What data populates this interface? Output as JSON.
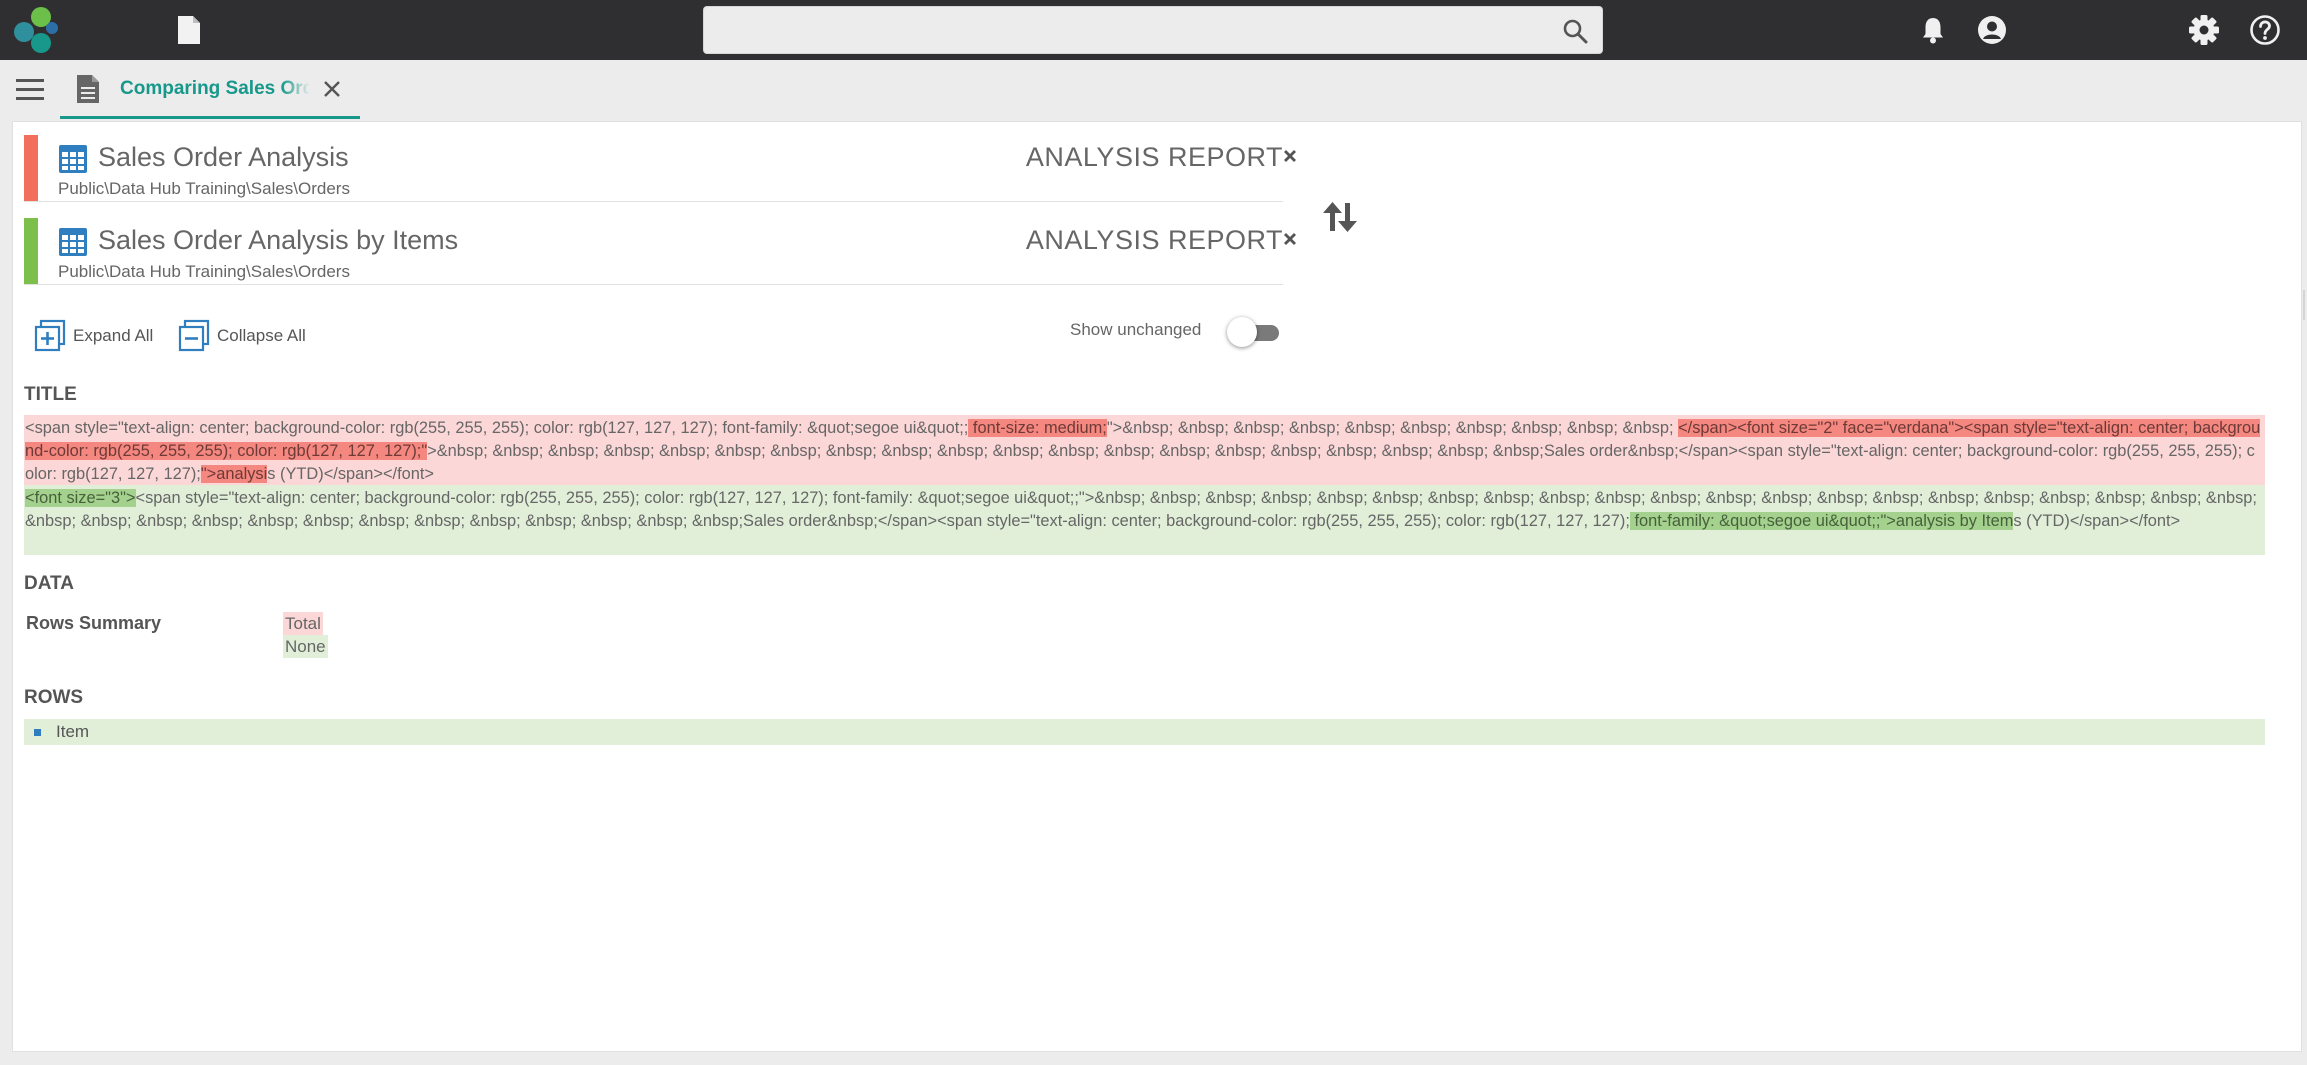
{
  "search": {
    "placeholder": ""
  },
  "tab": {
    "label": "Comparing Sales Order Analysis"
  },
  "reports": [
    {
      "title": "Sales Order Analysis",
      "path": "Public\\Data Hub Training\\Sales\\Orders",
      "type": "ANALYSIS REPORT",
      "color": "#f26f5e"
    },
    {
      "title": "Sales Order Analysis by Items",
      "path": "Public\\Data Hub Training\\Sales\\Orders",
      "type": "ANALYSIS REPORT",
      "color": "#7cc04b"
    }
  ],
  "remove_glyph": "×",
  "toolbar": {
    "expand_all": "Expand All",
    "collapse_all": "Collapse All",
    "show_unchanged": "Show unchanged",
    "show_unchanged_on": false
  },
  "sections": {
    "title": "TITLE",
    "data": "DATA",
    "rows": "ROWS"
  },
  "title_diff": {
    "old": [
      {
        "text": "<span style=\"text-align: center; background-color: rgb(255, 255, 255); color: rgb(127, 127, 127); font-family: &quot;segoe ui&quot;;",
        "hl": false
      },
      {
        "text": " font-size: medium;",
        "hl": true
      },
      {
        "text": "\">&nbsp; &nbsp; &nbsp; &nbsp; &nbsp; &nbsp; &nbsp; &nbsp; &nbsp; &nbsp; ",
        "hl": false
      },
      {
        "text": "</span><font size=\"2\" face=\"verdana\"><span style=\"text-align: center; background-color: rgb(255, 255, 255); color: rgb(127, 127, 127);\"",
        "hl": true
      },
      {
        "text": ">&nbsp; &nbsp; &nbsp; &nbsp; &nbsp; &nbsp; &nbsp; &nbsp; &nbsp; &nbsp; &nbsp; &nbsp; &nbsp; &nbsp; &nbsp; &nbsp; &nbsp; &nbsp; &nbsp; &nbsp;Sales order&nbsp;</span><span style=\"text-align: center; background-color: rgb(255, 255, 255); color: rgb(127, 127, 127);",
        "hl": false
      },
      {
        "text": "\">analysi",
        "hl": true
      },
      {
        "text": "s (YTD)</span></font>",
        "hl": false
      }
    ],
    "new": [
      {
        "text": "<font size=\"3\">",
        "hl": true
      },
      {
        "text": "<span style=\"text-align: center; background-color: rgb(255, 255, 255); color: rgb(127, 127, 127); font-family: &quot;segoe ui&quot;;\">&nbsp; &nbsp; &nbsp; &nbsp; &nbsp; &nbsp; &nbsp; &nbsp; &nbsp; &nbsp; &nbsp; &nbsp; &nbsp; &nbsp; &nbsp; &nbsp; &nbsp; &nbsp; &nbsp; &nbsp; &nbsp; &nbsp; &nbsp; &nbsp; &nbsp; &nbsp; &nbsp; &nbsp; &nbsp; &nbsp; &nbsp; &nbsp; &nbsp; &nbsp;Sales order&nbsp;</span><span style=\"text-align: center; background-color: rgb(255, 255, 255); color: rgb(127, 127, 127);",
        "hl": false
      },
      {
        "text": " font-family: &quot;segoe ui&quot;;\">analysis by Item",
        "hl": true
      },
      {
        "text": "s (YTD)</span></font>",
        "hl": false
      }
    ]
  },
  "data_diff": {
    "label": "Rows Summary",
    "old": "Total",
    "new": "None"
  },
  "rows_diff": {
    "items": [
      "Item"
    ]
  },
  "colors": {
    "accent": "#17988a",
    "removed_bg": "#fcd7d7",
    "removed_hl": "#f4877f",
    "added_bg": "#e1efd9",
    "added_hl": "#a4d28e",
    "icon_blue": "#2f7ebf",
    "topbar": "#2f2f31"
  }
}
